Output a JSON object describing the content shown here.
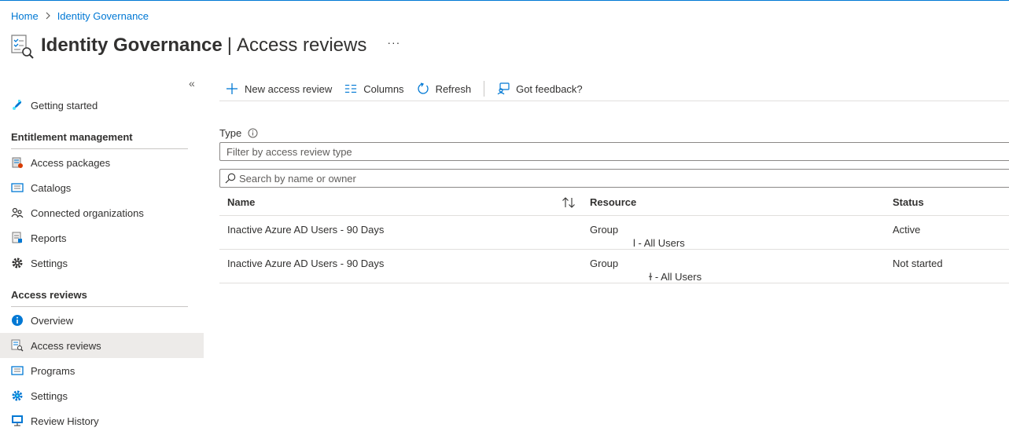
{
  "breadcrumb": {
    "home": "Home",
    "current": "Identity Governance"
  },
  "header": {
    "title_main": "Identity Governance",
    "divider": "|",
    "title_sub": "Access reviews",
    "more": "···"
  },
  "sidebar": {
    "collapse": "«",
    "getting_started": "Getting started",
    "section_entitlement": "Entitlement management",
    "entitlement_items": [
      "Access packages",
      "Catalogs",
      "Connected organizations",
      "Reports",
      "Settings"
    ],
    "section_access_reviews": "Access reviews",
    "access_review_items": [
      "Overview",
      "Access reviews",
      "Programs",
      "Settings",
      "Review History"
    ]
  },
  "toolbar": {
    "new_review": "New access review",
    "columns": "Columns",
    "refresh": "Refresh",
    "feedback": "Got feedback?"
  },
  "filter": {
    "type_label": "Type",
    "type_placeholder": "Filter by access review type",
    "search_placeholder": "Search by name or owner"
  },
  "table": {
    "headers": {
      "name": "Name",
      "resource": "Resource",
      "status": "Status"
    },
    "rows": [
      {
        "name": "Inactive Azure AD Users - 90 Days",
        "resource": "Group",
        "resource_sub": "l - All Users",
        "status": "Active"
      },
      {
        "name": "Inactive Azure AD Users - 90 Days",
        "resource": "Group",
        "resource_sub": "ɫ - All Users",
        "status": "Not started"
      }
    ]
  },
  "colors": {
    "accent": "#0078d4",
    "selected_bg": "#edebe9",
    "divider": "#e1dfdd"
  }
}
